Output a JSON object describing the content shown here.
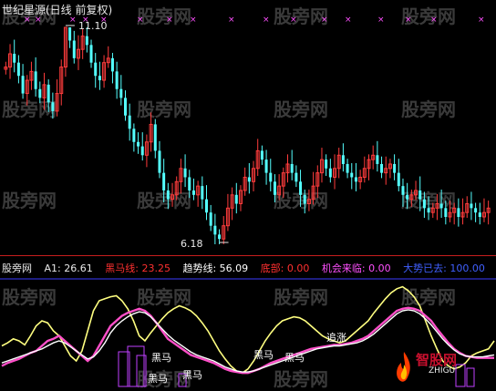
{
  "main_panel": {
    "title": "世纪星源(日线 前复权)",
    "high_label": "11.10",
    "low_label": "6.18"
  },
  "watermarks": [
    "股旁网",
    "股旁网",
    "股旁网",
    "股旁网",
    "股旁网",
    "股旁网",
    "股旁网",
    "股旁网",
    "股旁网",
    "股旁网",
    "股旁网",
    "股旁网",
    "股旁网",
    "股旁网",
    "股旁网",
    "股旁网",
    "股旁网",
    "股旁网"
  ],
  "indicator": {
    "name": "股旁网",
    "a1_label": "A1:",
    "a1_value": "26.61",
    "hm_label": "黑马线:",
    "hm_value": "23.25",
    "trend_label": "趋势线:",
    "trend_value": "56.09",
    "bottom_label": "底部:",
    "bottom_value": "0.00",
    "chance_label": "机会来临:",
    "chance_value": "0.00",
    "bull_label": "大势已去:",
    "bull_value": "100.00"
  },
  "annotations": [
    "黑马",
    "黑马",
    "黑马",
    "追涨",
    "黑马",
    "黑马"
  ],
  "brand": {
    "name": "智股网",
    "sub": "ZHIGU"
  },
  "colors": {
    "up": "#ff3c3c",
    "down": "#54ffff",
    "white": "#ffffff",
    "yellow": "#ffff80",
    "magenta": "#ff4fc9",
    "pink": "#ff3296",
    "blue": "#3c3cff",
    "purple": "#c040ff",
    "red": "#ff3030",
    "magenta_label": "#ff50ff"
  },
  "chart_data": [
    {
      "type": "candlestick",
      "title": "世纪星源(日线 前复权)",
      "price_range": [
        6.18,
        11.1
      ],
      "marked_high": 11.1,
      "marked_low": 6.18,
      "closes": [
        10.2,
        10.5,
        10.3,
        10.0,
        9.6,
        9.9,
        10.1,
        9.7,
        9.5,
        9.8,
        9.4,
        9.2,
        9.6,
        10.2,
        11.1,
        10.8,
        10.4,
        10.6,
        10.9,
        10.7,
        10.3,
        10.0,
        9.9,
        10.3,
        10.4,
        10.1,
        9.7,
        9.5,
        9.1,
        8.8,
        8.5,
        8.4,
        8.2,
        8.5,
        8.9,
        8.3,
        7.8,
        7.4,
        7.2,
        7.3,
        7.6,
        7.9,
        7.7,
        7.4,
        7.3,
        7.5,
        7.2,
        6.9,
        6.6,
        6.4,
        6.3,
        6.6,
        7.0,
        7.3,
        7.1,
        7.4,
        7.7,
        7.6,
        7.9,
        8.3,
        8.1,
        7.8,
        7.6,
        7.3,
        7.5,
        7.8,
        8.0,
        7.8,
        7.6,
        7.3,
        7.1,
        7.2,
        7.5,
        7.8,
        8.1,
        7.9,
        7.7,
        7.9,
        8.2,
        8.0,
        7.8,
        7.7,
        7.6,
        7.7,
        7.9,
        8.1,
        8.2,
        8.0,
        7.8,
        7.9,
        8.0,
        7.8,
        7.5,
        7.3,
        7.2,
        7.3,
        7.4,
        7.2,
        7.0,
        6.9,
        7.0,
        7.1,
        7.0,
        6.8,
        6.9,
        7.0,
        6.8,
        6.9,
        7.1,
        7.0,
        6.9,
        6.8,
        6.9,
        7.0
      ],
      "signal_markers": "x"
    },
    {
      "type": "line",
      "series": [
        {
          "name": "A1",
          "values": [
            35,
            38,
            42,
            40,
            36,
            45,
            55,
            60,
            58,
            50,
            45,
            35,
            25,
            20,
            30,
            50,
            70,
            80,
            82,
            84,
            85,
            80,
            72,
            60,
            45,
            40,
            48,
            55,
            62,
            68,
            72,
            75,
            73,
            70,
            65,
            58,
            50,
            40,
            30,
            22,
            15,
            10,
            8,
            12,
            20,
            30,
            40,
            48,
            55,
            60,
            62,
            64,
            63,
            60,
            55,
            50,
            45,
            42,
            40,
            38,
            40,
            45,
            50,
            55,
            60,
            68,
            75,
            82,
            88,
            92,
            94,
            90,
            84,
            75,
            60,
            45,
            32,
            20,
            15,
            12,
            14,
            18,
            25,
            28,
            30,
            32,
            40
          ]
        },
        {
          "name": "黑马线",
          "values": [
            15,
            18,
            20,
            22,
            25,
            28,
            30,
            35,
            40,
            42,
            45,
            40,
            35,
            30,
            25,
            20,
            25,
            35,
            45,
            55,
            60,
            65,
            68,
            70,
            72,
            70,
            65,
            58,
            50,
            42,
            38,
            34,
            30,
            26,
            24,
            22,
            20,
            18,
            15,
            12,
            10,
            9,
            8,
            8,
            10,
            12,
            15,
            18,
            20,
            22,
            24,
            26,
            28,
            30,
            32,
            33,
            34,
            35,
            36,
            36,
            37,
            38,
            40,
            42,
            45,
            50,
            55,
            60,
            65,
            70,
            72,
            73,
            72,
            70,
            65,
            60,
            52,
            45,
            38,
            32,
            28,
            25,
            24,
            23,
            23,
            23,
            23
          ]
        },
        {
          "name": "趋势线",
          "values": [
            18,
            20,
            22,
            24,
            26,
            28,
            30,
            32,
            35,
            38,
            40,
            38,
            34,
            30,
            26,
            22,
            24,
            30,
            38,
            48,
            55,
            60,
            64,
            67,
            69,
            68,
            64,
            58,
            52,
            46,
            41,
            37,
            33,
            29,
            26,
            24,
            22,
            20,
            17,
            14,
            12,
            10,
            9,
            9,
            10,
            12,
            14,
            16,
            18,
            20,
            22,
            24,
            26,
            28,
            30,
            32,
            33,
            34,
            35,
            35,
            36,
            37,
            38,
            40,
            43,
            47,
            52,
            57,
            62,
            67,
            70,
            71,
            70,
            67,
            62,
            56,
            49,
            42,
            36,
            31,
            27,
            25,
            24,
            24,
            24,
            25,
            26
          ]
        }
      ],
      "bands": [
        "底部",
        "机会来临",
        "大势已去"
      ]
    }
  ]
}
